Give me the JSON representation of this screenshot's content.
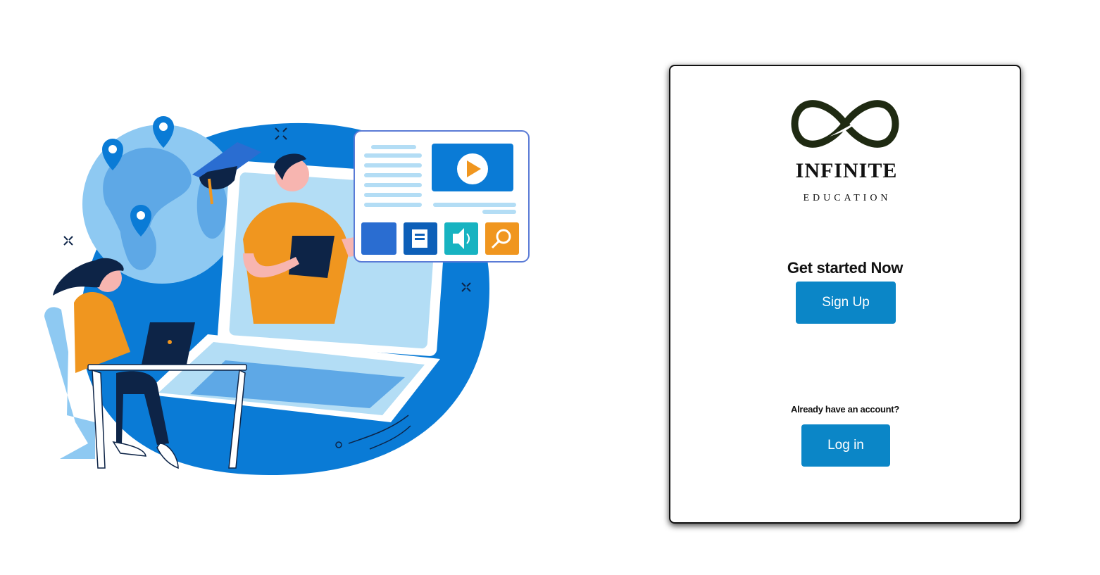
{
  "brand": {
    "name": "INFINITE",
    "tagline": "EDUCATION",
    "logo_icon": "infinity-logo-icon",
    "logo_color": "#1f2a12"
  },
  "hero": {
    "illustration": "online-education-illustration"
  },
  "signup": {
    "heading": "Get started Now",
    "button_label": "Sign Up"
  },
  "login": {
    "prompt": "Already have an account?",
    "button_label": "Log in"
  },
  "colors": {
    "accent": "#0b86c7",
    "illustration_blue": "#0a7bd6",
    "illustration_light_blue": "#b3ddf5",
    "illustration_orange": "#f0961f",
    "illustration_navy": "#0d2447"
  }
}
